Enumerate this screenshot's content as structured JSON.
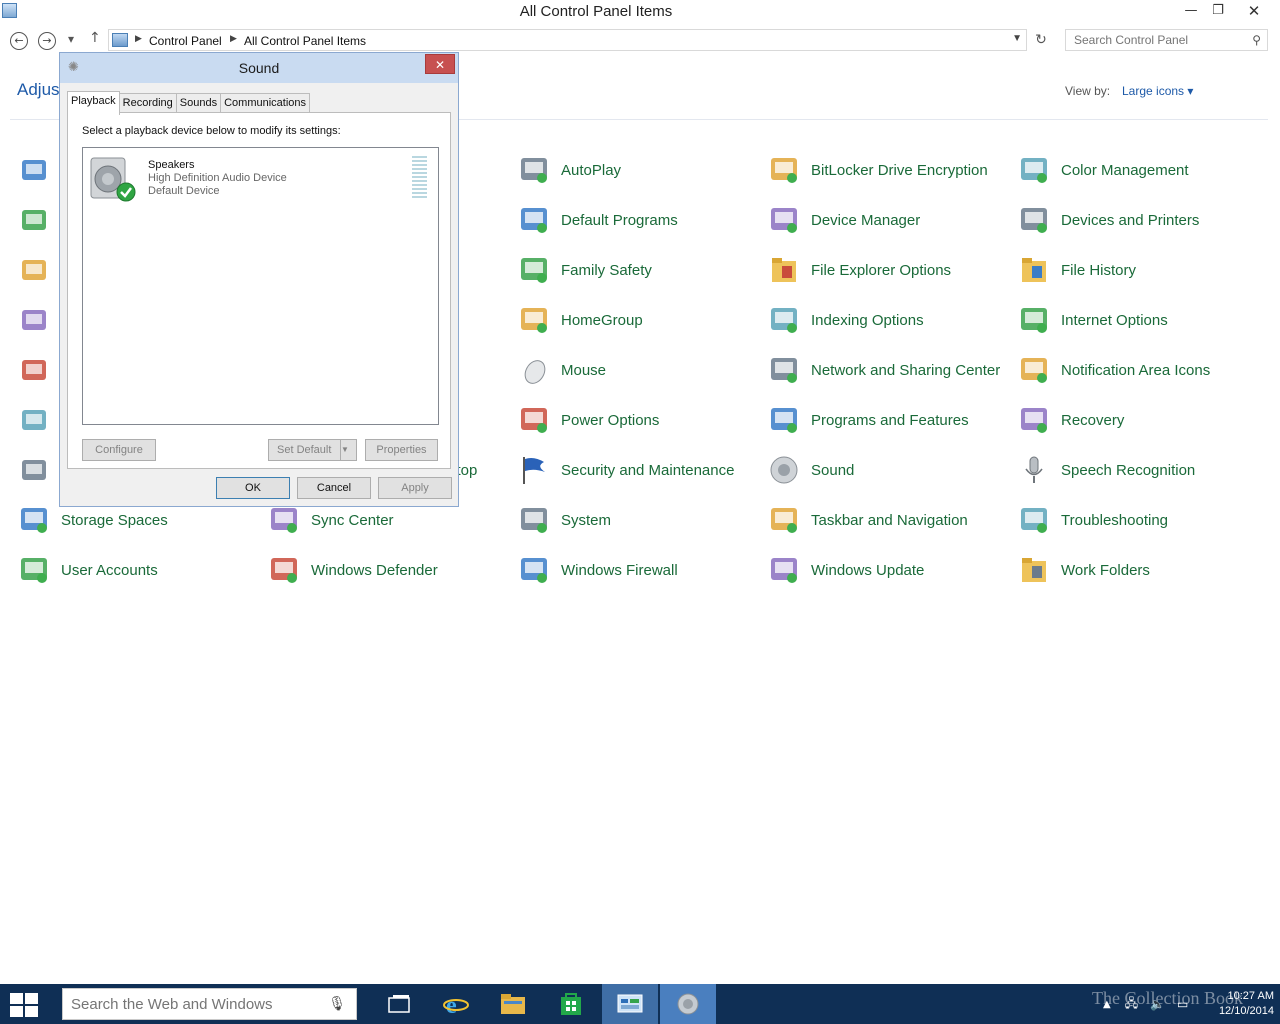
{
  "window": {
    "title": "All Control Panel Items",
    "minimize": "—",
    "restore": "❐",
    "close": "✕"
  },
  "nav": {
    "back": "←",
    "forward": "→",
    "recent": "▾",
    "up": "↑",
    "breadcrumb": [
      "Control Panel",
      "All Control Panel Items"
    ],
    "search_placeholder": "Search Control Panel"
  },
  "header": {
    "adjust_partial": "Adjust",
    "view_by_label": "View by:",
    "view_by_value": "Large icons ▾"
  },
  "items": {
    "c0": [
      "",
      "",
      "",
      "",
      "",
      "",
      "",
      "Storage Spaces",
      "User Accounts"
    ],
    "c1": [
      "",
      "",
      "",
      "",
      "",
      "",
      "ktop",
      "Sync Center",
      "Windows Defender"
    ],
    "c2": [
      "AutoPlay",
      "Default Programs",
      "Family Safety",
      "HomeGroup",
      "Mouse",
      "Power Options",
      "Security and Maintenance",
      "System",
      "Windows Firewall"
    ],
    "c3": [
      "BitLocker Drive Encryption",
      "Device Manager",
      "File Explorer Options",
      "Indexing Options",
      "Network and Sharing Center",
      "Programs and Features",
      "Sound",
      "Taskbar and Navigation",
      "Windows Update"
    ],
    "c4": [
      "Color Management",
      "Devices and Printers",
      "File History",
      "Internet Options",
      "Notification Area Icons",
      "Recovery",
      "Speech Recognition",
      "Troubleshooting",
      "Work Folders"
    ]
  },
  "dialog": {
    "title": "Sound",
    "close": "✕",
    "tabs": [
      "Playback",
      "Recording",
      "Sounds",
      "Communications"
    ],
    "instruction": "Select a playback device below to modify its settings:",
    "device": {
      "name": "Speakers",
      "driver": "High Definition Audio Device",
      "status": "Default Device"
    },
    "configure": "Configure",
    "set_default": "Set Default",
    "properties": "Properties",
    "ok": "OK",
    "cancel": "Cancel",
    "apply": "Apply"
  },
  "taskbar": {
    "search_placeholder": "Search the Web and Windows",
    "time": "10:27 AM",
    "date": "12/10/2014",
    "watermark": "The Collection Book"
  }
}
